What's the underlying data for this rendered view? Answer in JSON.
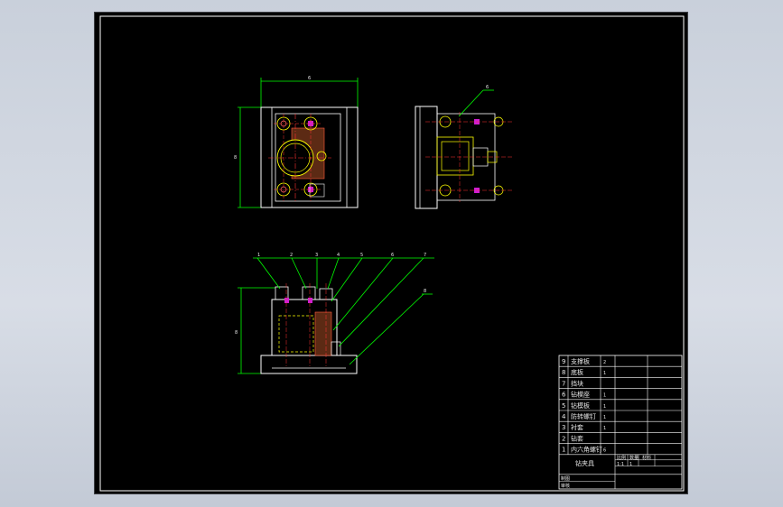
{
  "drawing": {
    "dimensions": {
      "top_width": "6",
      "top_height": "8",
      "front_height": "8"
    },
    "side_balloon": "6",
    "front_balloons": [
      "1",
      "2",
      "3",
      "4",
      "5",
      "6",
      "7",
      "8"
    ]
  },
  "title_block": {
    "parts": [
      {
        "no": "9",
        "name": "支撑板",
        "qty": "2"
      },
      {
        "no": "8",
        "name": "底板",
        "qty": "1"
      },
      {
        "no": "7",
        "name": "挡块",
        "qty": ""
      },
      {
        "no": "6",
        "name": "钻模座",
        "qty": "1"
      },
      {
        "no": "5",
        "name": "钻模板",
        "qty": "1"
      },
      {
        "no": "4",
        "name": "防转螺钉",
        "qty": "1"
      },
      {
        "no": "3",
        "name": "衬套",
        "qty": "1"
      },
      {
        "no": "2",
        "name": "钻套",
        "qty": ""
      },
      {
        "no": "1",
        "name": "内六角螺钉",
        "qty": "6"
      }
    ],
    "title": "钻夹具",
    "col_labels": [
      "比例",
      "数量",
      "材料"
    ],
    "row_values": [
      "1:1",
      "1"
    ],
    "footer_labels": [
      "制图",
      "审核"
    ]
  }
}
